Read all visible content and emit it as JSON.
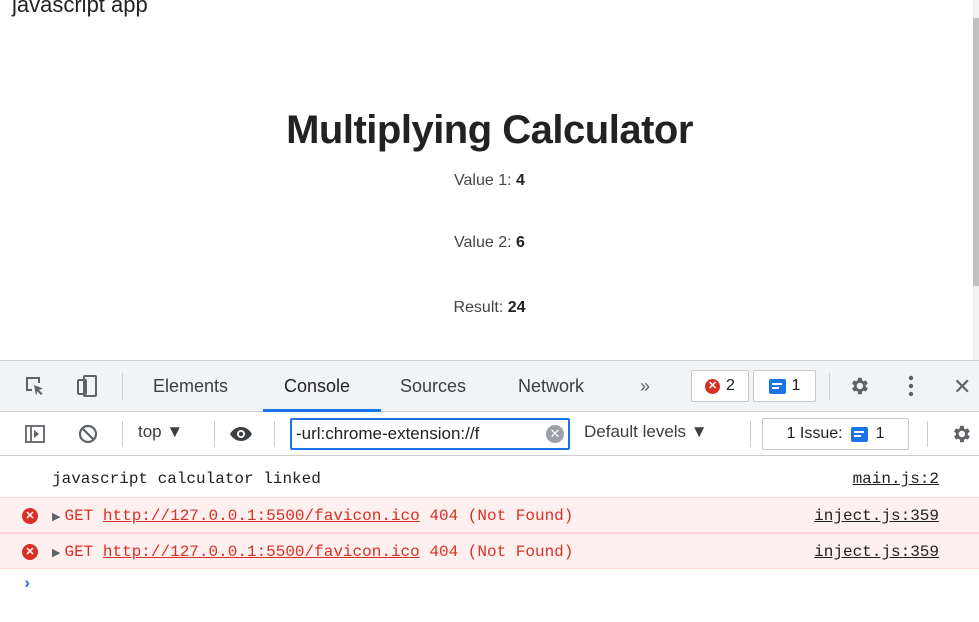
{
  "page": {
    "clipped_header": "javascript app",
    "title": "Multiplying Calculator",
    "value1_label": "Value 1:",
    "value1": "4",
    "value2_label": "Value 2:",
    "value2": "6",
    "result_label": "Result:",
    "result": "24"
  },
  "devtools": {
    "tabs": [
      {
        "label": "Elements"
      },
      {
        "label": "Console"
      },
      {
        "label": "Sources"
      },
      {
        "label": "Network"
      }
    ],
    "more_tabs": "»",
    "error_count": "2",
    "message_count": "1",
    "close": "✕",
    "context": "top ▼",
    "filter_value": "-url:chrome-extension://f",
    "levels": "Default levels ▼",
    "issues_label": "1 Issue:",
    "issues_count": "1",
    "console": {
      "log": {
        "text": "javascript calculator linked",
        "source": "main.js:2"
      },
      "errors": [
        {
          "method": "GET",
          "url": "http://127.0.0.1:5500/favicon.ico",
          "status": "404 (Not Found)",
          "source": "inject.js:359"
        },
        {
          "method": "GET",
          "url": "http://127.0.0.1:5500/favicon.ico",
          "status": "404 (Not Found)",
          "source": "inject.js:359"
        }
      ],
      "prompt": "›"
    },
    "accent_color": "#1a73e8",
    "error_color": "#d93025"
  }
}
